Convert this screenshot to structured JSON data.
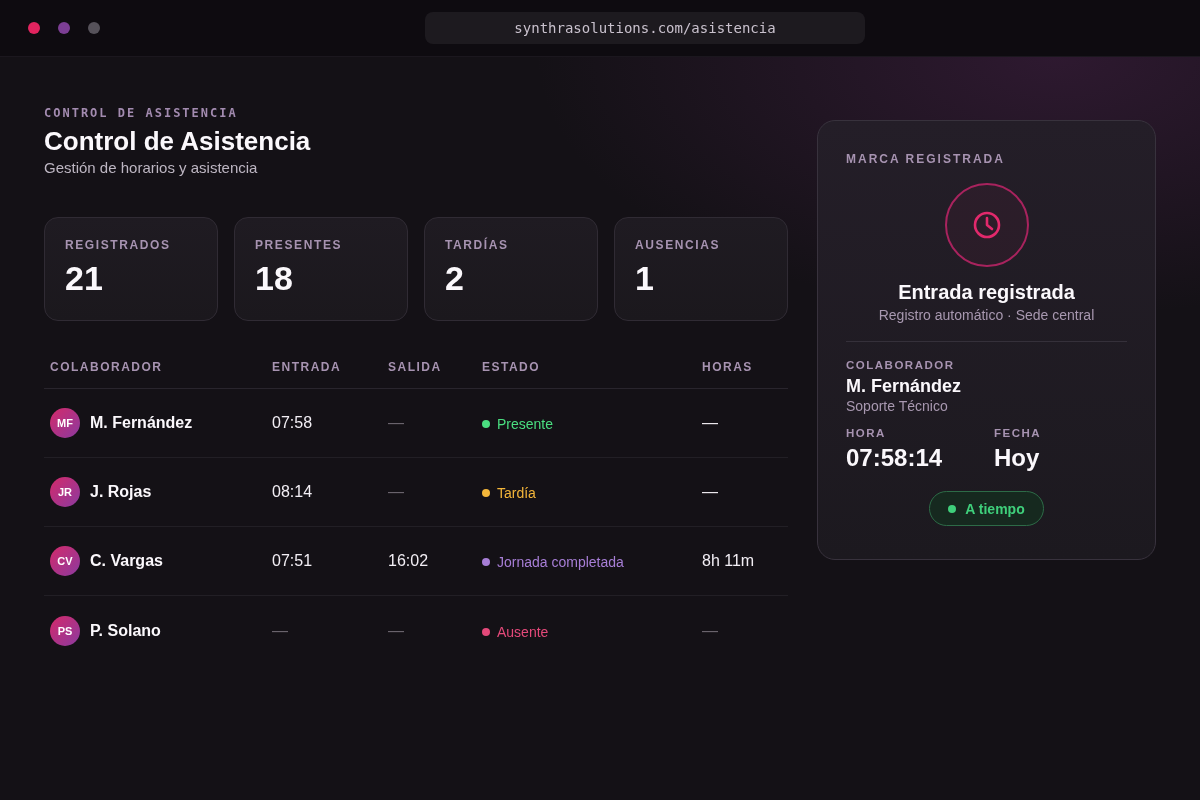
{
  "browser": {
    "url": "synthrasolutions.com/asistencia"
  },
  "header": {
    "eyebrow": "CONTROL DE ASISTENCIA",
    "title": "Control de Asistencia",
    "subtitle": "Gestión de horarios y asistencia"
  },
  "stats": [
    {
      "label": "REGISTRADOS",
      "value": "21"
    },
    {
      "label": "PRESENTES",
      "value": "18"
    },
    {
      "label": "TARDÍAS",
      "value": "2"
    },
    {
      "label": "AUSENCIAS",
      "value": "1"
    }
  ],
  "table": {
    "columns": [
      "COLABORADOR",
      "ENTRADA",
      "SALIDA",
      "ESTADO",
      "HORAS"
    ],
    "rows": [
      {
        "initials": "MF",
        "name": "M. Fernández",
        "entrada": {
          "text": "07:58",
          "muted": false
        },
        "salida": {
          "text": "—",
          "muted": true
        },
        "status": {
          "label": "Presente",
          "color": "#4ade80"
        },
        "horas": {
          "text": "—",
          "muted": false
        }
      },
      {
        "initials": "JR",
        "name": "J. Rojas",
        "entrada": {
          "text": "08:14",
          "muted": false
        },
        "salida": {
          "text": "—",
          "muted": true
        },
        "status": {
          "label": "Tardía",
          "color": "#f4b63a"
        },
        "horas": {
          "text": "—",
          "muted": false
        }
      },
      {
        "initials": "CV",
        "name": "C. Vargas",
        "entrada": {
          "text": "07:51",
          "muted": false
        },
        "salida": {
          "text": "16:02",
          "muted": false
        },
        "status": {
          "label": "Jornada completada",
          "color": "#a77ed6"
        },
        "horas": {
          "text": "8h 11m",
          "muted": false
        }
      },
      {
        "initials": "PS",
        "name": "P. Solano",
        "entrada": {
          "text": "—",
          "muted": true
        },
        "salida": {
          "text": "—",
          "muted": true
        },
        "status": {
          "label": "Ausente",
          "color": "#e4497a"
        },
        "horas": {
          "text": "—",
          "muted": true
        }
      }
    ]
  },
  "record": {
    "eyebrow": "MARCA REGISTRADA",
    "title": "Entrada registrada",
    "subtitle": "Registro automático · Sede central",
    "collaborator_label": "COLABORADOR",
    "collaborator_name": "M. Fernández",
    "collaborator_role": "Soporte Técnico",
    "fields": [
      {
        "label": "HORA",
        "value": "07:58:14"
      },
      {
        "label": "FECHA",
        "value": "Hoy"
      }
    ],
    "badge": {
      "label": "A tiempo"
    }
  }
}
